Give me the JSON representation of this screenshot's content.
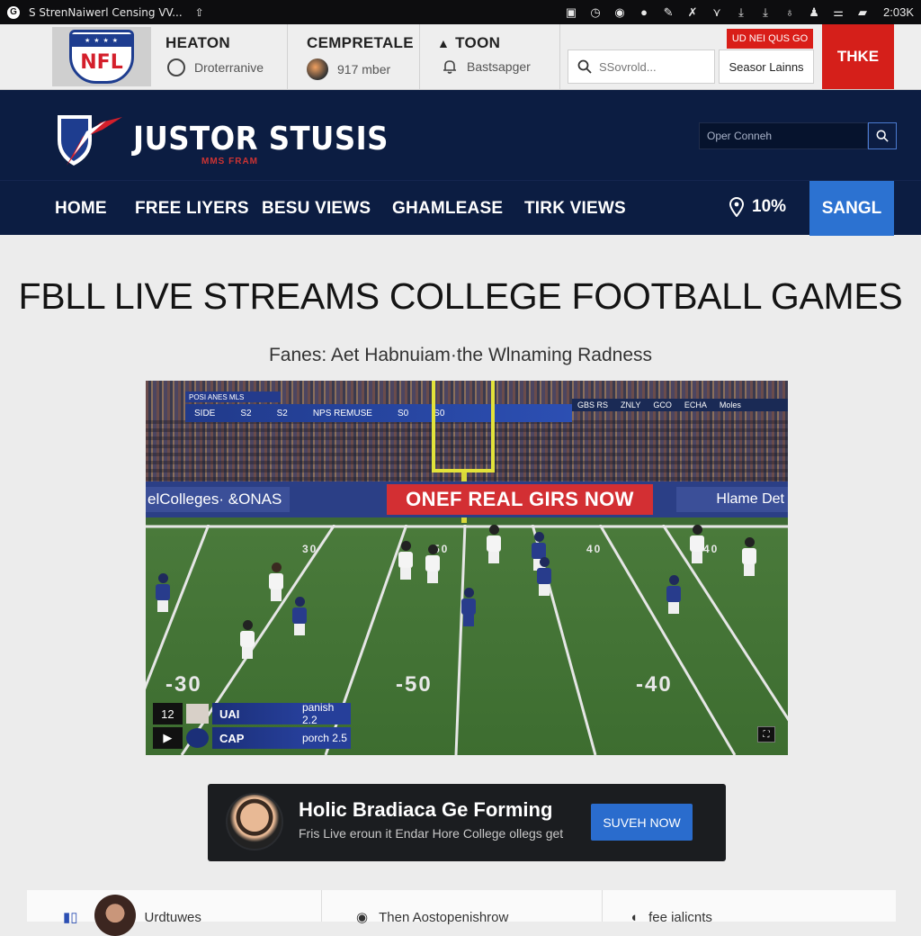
{
  "statusbar": {
    "title": "S StrenNaiwerl Censing VV...",
    "clock": "2:03K"
  },
  "topbar": {
    "logo_text": "NFL",
    "col1": {
      "heading": "HEATON",
      "sub": "Droterranive"
    },
    "col2": {
      "heading": "CEMPRETALE",
      "sub": "917 mber"
    },
    "col3": {
      "heading": "TOON",
      "sub": "Bastsapger"
    },
    "search_placeholder": "SSovrold...",
    "season_button": "Seasor Lainns",
    "promo_label": "UD NEI QUS GO",
    "red_button": "THKE"
  },
  "brand": {
    "name": "JUSTOR STUSIS",
    "tagline": "MMS FRAM",
    "search_placeholder": "Oper Conneh"
  },
  "nav": {
    "items": [
      "HOME",
      "FREE LIYERS",
      "BESU VIEWS",
      "GHAMLEASE",
      "TIRK VIEWS"
    ],
    "percent": "10%",
    "cta": "SANGL"
  },
  "main": {
    "title": "FBLL LIVE STREAMS COLLEGE FOOTBALL GAMES",
    "subtitle": "Fanes: Aet Habnuiam·the Wlnaming Radness"
  },
  "video": {
    "ad_left": "elColleges· &ONAS",
    "ad_center": "ONEF REAL GIRS NOW",
    "ad_right": "Hlame Det",
    "ribbon_top": "POSI ANES MLS",
    "ribbon": [
      "SIDE",
      "S2",
      "S2",
      "NPS REMUSE",
      "S0",
      "S0"
    ],
    "ribbon_right": [
      "GBS RS",
      "ZNLY",
      "GCO",
      "ECHA",
      "Moles"
    ],
    "yard_left": "-30",
    "yard_center": "-50",
    "yard_right": "-40",
    "yard_small": [
      "30",
      "50",
      "40",
      "40"
    ],
    "score_rows": [
      {
        "num": "12",
        "team": "UAI",
        "val": "panish 2.2"
      },
      {
        "num": "▶",
        "team": "CAP",
        "val": "porch 2.5"
      }
    ]
  },
  "card": {
    "title": "Holic Bradiaca Ge Forming",
    "text": "Fris Live eroun it Endar Hore College ollegs get",
    "button": "SUVEH NOW"
  },
  "bottom": {
    "items": [
      "Urdtuwes",
      "Then Aostopenishrow",
      "fee ialicnts"
    ]
  },
  "colors": {
    "navy": "#0c1d42",
    "accent_blue": "#2c72d1",
    "accent_red": "#d51f1a"
  }
}
